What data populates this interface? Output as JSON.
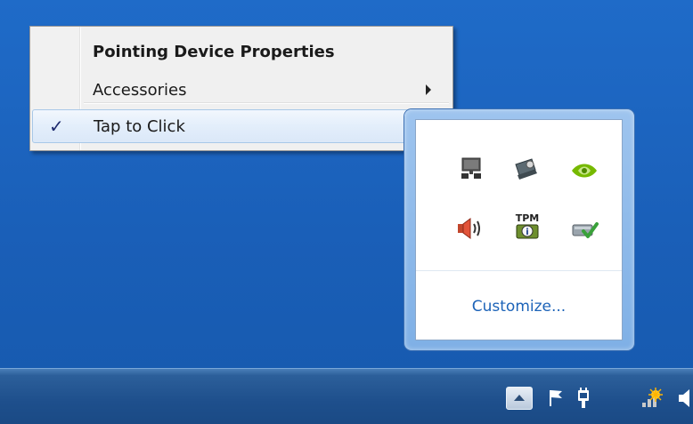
{
  "context_menu": {
    "items": [
      {
        "label": "Pointing Device Properties",
        "bold": true
      },
      {
        "label": "Accessories",
        "submenu": true
      },
      {
        "label": "Tap to Click",
        "checked": true,
        "check_glyph": "✓"
      }
    ]
  },
  "tray_flyout": {
    "icons": [
      "network-adapter-icon",
      "computer-warning-icon",
      "nvidia-icon",
      "speaker-volume-icon",
      "tpm-icon",
      "drive-check-icon"
    ],
    "tpm_label_top": "TPM",
    "tpm_label_bottom": "i",
    "customize_label": "Customize..."
  },
  "taskbar": {
    "tray_icons": [
      "show-hidden-icons-button",
      "action-center-flag-icon",
      "power-plug-icon",
      "network-signal-icon",
      "volume-icon"
    ]
  },
  "colors": {
    "desktop": "#1a5fb8",
    "link": "#1c63b8",
    "check": "#1e2a6e"
  }
}
